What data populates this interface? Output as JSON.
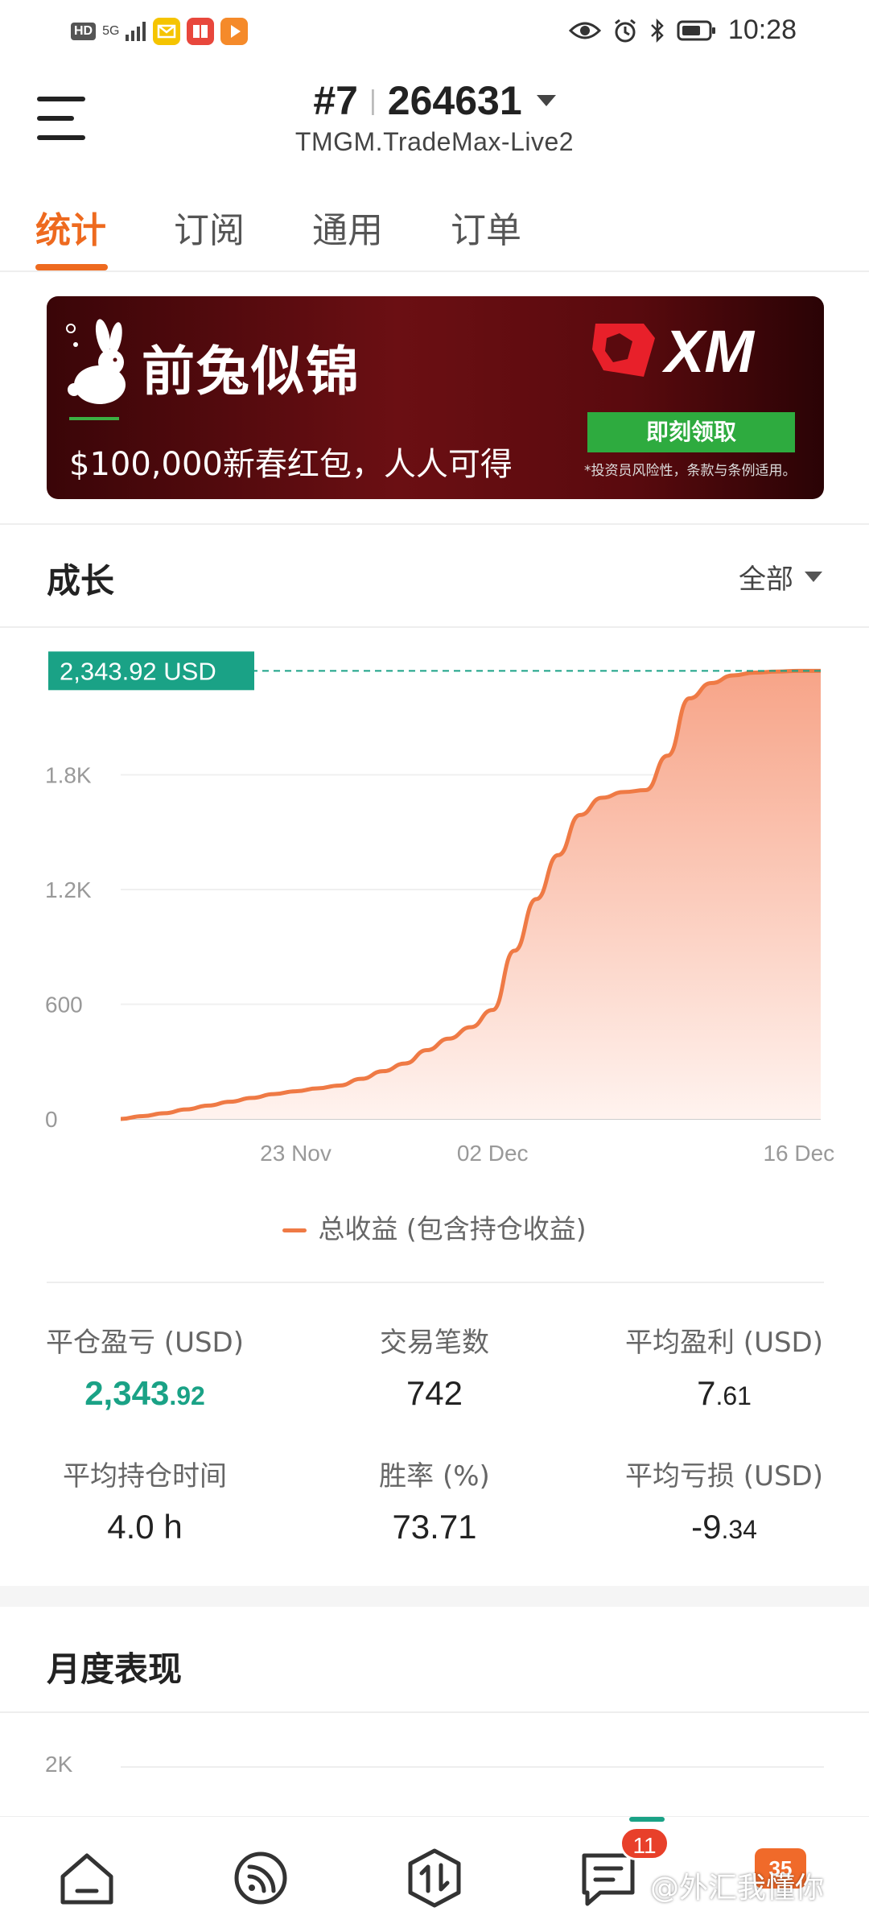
{
  "status_bar": {
    "left_badges": [
      "HD",
      "5G"
    ],
    "time": "10:28"
  },
  "header": {
    "account_prefix": "#7",
    "account_number": "264631",
    "server": "TMGM.TradeMax-Live2"
  },
  "tabs": [
    {
      "label": "统计",
      "active": true
    },
    {
      "label": "订阅",
      "active": false
    },
    {
      "label": "通用",
      "active": false
    },
    {
      "label": "订单",
      "active": false
    }
  ],
  "banner": {
    "headline": "前兔似锦",
    "subline": "$100,000新春红包，人人可得",
    "logo_text": "XM",
    "cta_label": "即刻领取",
    "disclaimer": "*投资员风险性，条款与条例适用。"
  },
  "growth": {
    "title": "成长",
    "range_label": "全部",
    "current_value_label": "2,343.92 USD",
    "legend_label": "总收益 (包含持仓收益)"
  },
  "chart_data": {
    "type": "area",
    "title": "",
    "xlabel": "",
    "ylabel": "",
    "ylim": [
      0,
      2400
    ],
    "y_ticks": [
      "0",
      "600",
      "1.2K",
      "1.8K"
    ],
    "x_ticks": [
      "23 Nov",
      "02 Dec",
      "16 Dec"
    ],
    "x_range": [
      "2022-11-15",
      "2022-12-17"
    ],
    "grid": true,
    "legend_position": "bottom",
    "colors": {
      "line": "#ef7a45",
      "fill_top": "#f7a488",
      "fill_bottom": "#fff3ef",
      "reference_line": "#1aa286"
    },
    "series": [
      {
        "name": "总收益 (包含持仓收益)",
        "x": [
          "2022-11-15",
          "2022-11-16",
          "2022-11-17",
          "2022-11-18",
          "2022-11-19",
          "2022-11-20",
          "2022-11-21",
          "2022-11-22",
          "2022-11-23",
          "2022-11-24",
          "2022-11-25",
          "2022-11-26",
          "2022-11-27",
          "2022-11-28",
          "2022-11-29",
          "2022-11-30",
          "2022-12-01",
          "2022-12-02",
          "2022-12-03",
          "2022-12-04",
          "2022-12-05",
          "2022-12-06",
          "2022-12-07",
          "2022-12-08",
          "2022-12-09",
          "2022-12-10",
          "2022-12-11",
          "2022-12-12",
          "2022-12-13",
          "2022-12-14",
          "2022-12-15",
          "2022-12-16",
          "2022-12-17"
        ],
        "values": [
          0,
          15,
          30,
          50,
          70,
          90,
          110,
          130,
          145,
          160,
          175,
          210,
          250,
          290,
          360,
          420,
          480,
          570,
          880,
          1150,
          1380,
          1590,
          1680,
          1710,
          1720,
          1900,
          2200,
          2280,
          2320,
          2335,
          2340,
          2343.92,
          2343.92
        ]
      }
    ],
    "reference_value": 2343.92
  },
  "stats": [
    {
      "label": "平仓盈亏 (USD)",
      "value_main": "2,343",
      "value_frac": ".92",
      "highlight": true
    },
    {
      "label": "交易笔数",
      "value_main": "742",
      "value_frac": "",
      "highlight": false
    },
    {
      "label": "平均盈利 (USD)",
      "value_main": "7",
      "value_frac": ".61",
      "highlight": false
    },
    {
      "label": "平均持仓时间",
      "value_main": "4.0 h",
      "value_frac": "",
      "highlight": false
    },
    {
      "label": "胜率 (%)",
      "value_main": "73.71",
      "value_frac": "",
      "highlight": false
    },
    {
      "label": "平均亏损 (USD)",
      "value_main": "-9",
      "value_frac": ".34",
      "highlight": false
    }
  ],
  "monthly": {
    "title": "月度表现",
    "y_tick_top": "2K"
  },
  "bottom_nav": {
    "items": [
      {
        "icon": "home-icon"
      },
      {
        "icon": "signal-feed-icon"
      },
      {
        "icon": "trade-icon"
      },
      {
        "icon": "messages-icon"
      }
    ],
    "badge_count": "11",
    "active_index": 3
  },
  "watermark": {
    "text": "@外汇我懂你",
    "badge": "35"
  }
}
